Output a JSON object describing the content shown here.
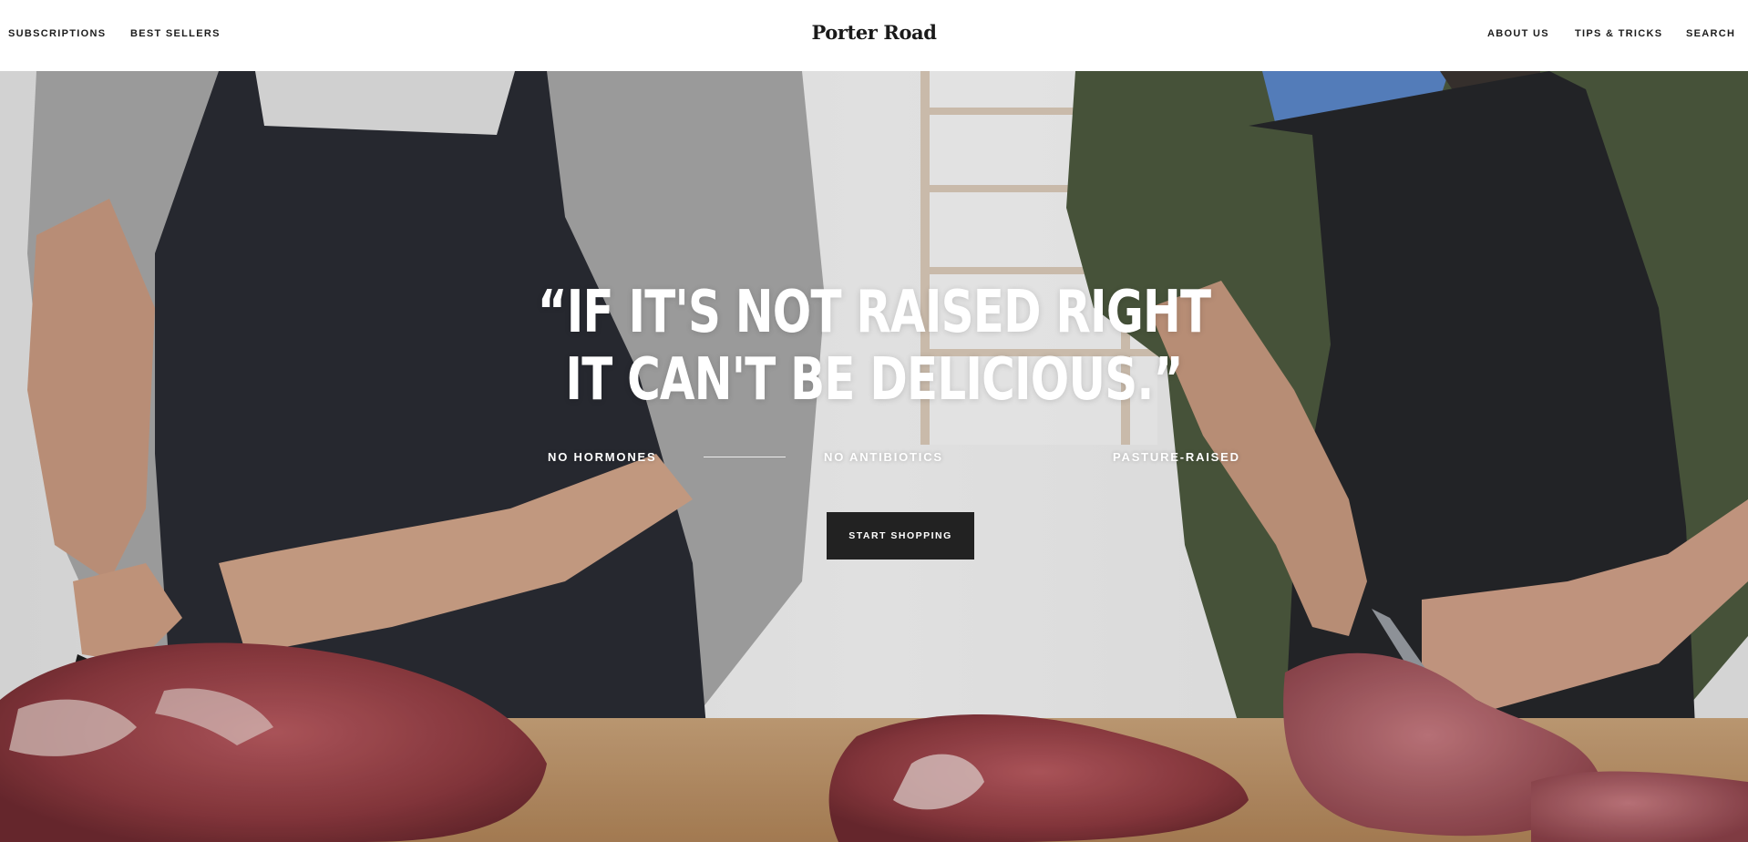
{
  "header": {
    "logo": "Porter Road",
    "nav_left": [
      {
        "label": "SUBSCRIPTIONS"
      },
      {
        "label": "BEST SELLERS"
      }
    ],
    "nav_right": [
      {
        "label": "ABOUT US"
      },
      {
        "label": "TIPS & TRICKS"
      },
      {
        "label": "SEARCH"
      }
    ]
  },
  "hero": {
    "headline_line1": "“IF IT'S NOT RAISED RIGHT",
    "headline_line2": "IT CAN'T BE DELICIOUS.”",
    "features": [
      "NO HORMONES",
      "NO ANTIBIOTICS",
      "PASTURE-RAISED"
    ],
    "cta_label": "START SHOPPING"
  },
  "colors": {
    "header_bg": "#ffffff",
    "text_dark": "#1c1c1c",
    "cta_bg": "#222222",
    "headline": "#ffffff"
  }
}
